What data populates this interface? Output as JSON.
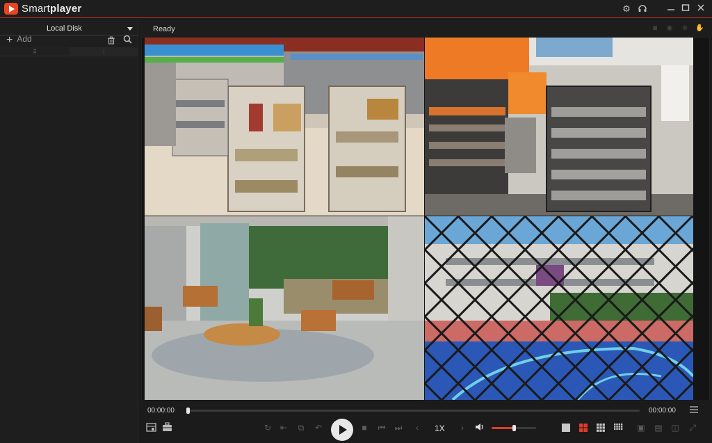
{
  "app": {
    "name_light": "Smart",
    "name_bold": "player"
  },
  "titlebar": {
    "icons": [
      "gear-icon",
      "headset-icon",
      "minimize-icon",
      "maximize-icon",
      "close-icon"
    ]
  },
  "sidebar": {
    "dropdown_label": "Local Disk",
    "add_label": "Add",
    "col_a": "⠿",
    "col_b": "⋮"
  },
  "status": {
    "text": "Ready"
  },
  "player": {
    "current_time": "00:00:00",
    "total_time": "00:00:00",
    "speed": "1X",
    "progress": 0,
    "volume": 0.5
  },
  "layout_buttons": [
    "single-view",
    "quad-view",
    "nine-view",
    "sixteen-view"
  ],
  "colors": {
    "accent": "#e03b2b",
    "brand": "#e8441f"
  }
}
